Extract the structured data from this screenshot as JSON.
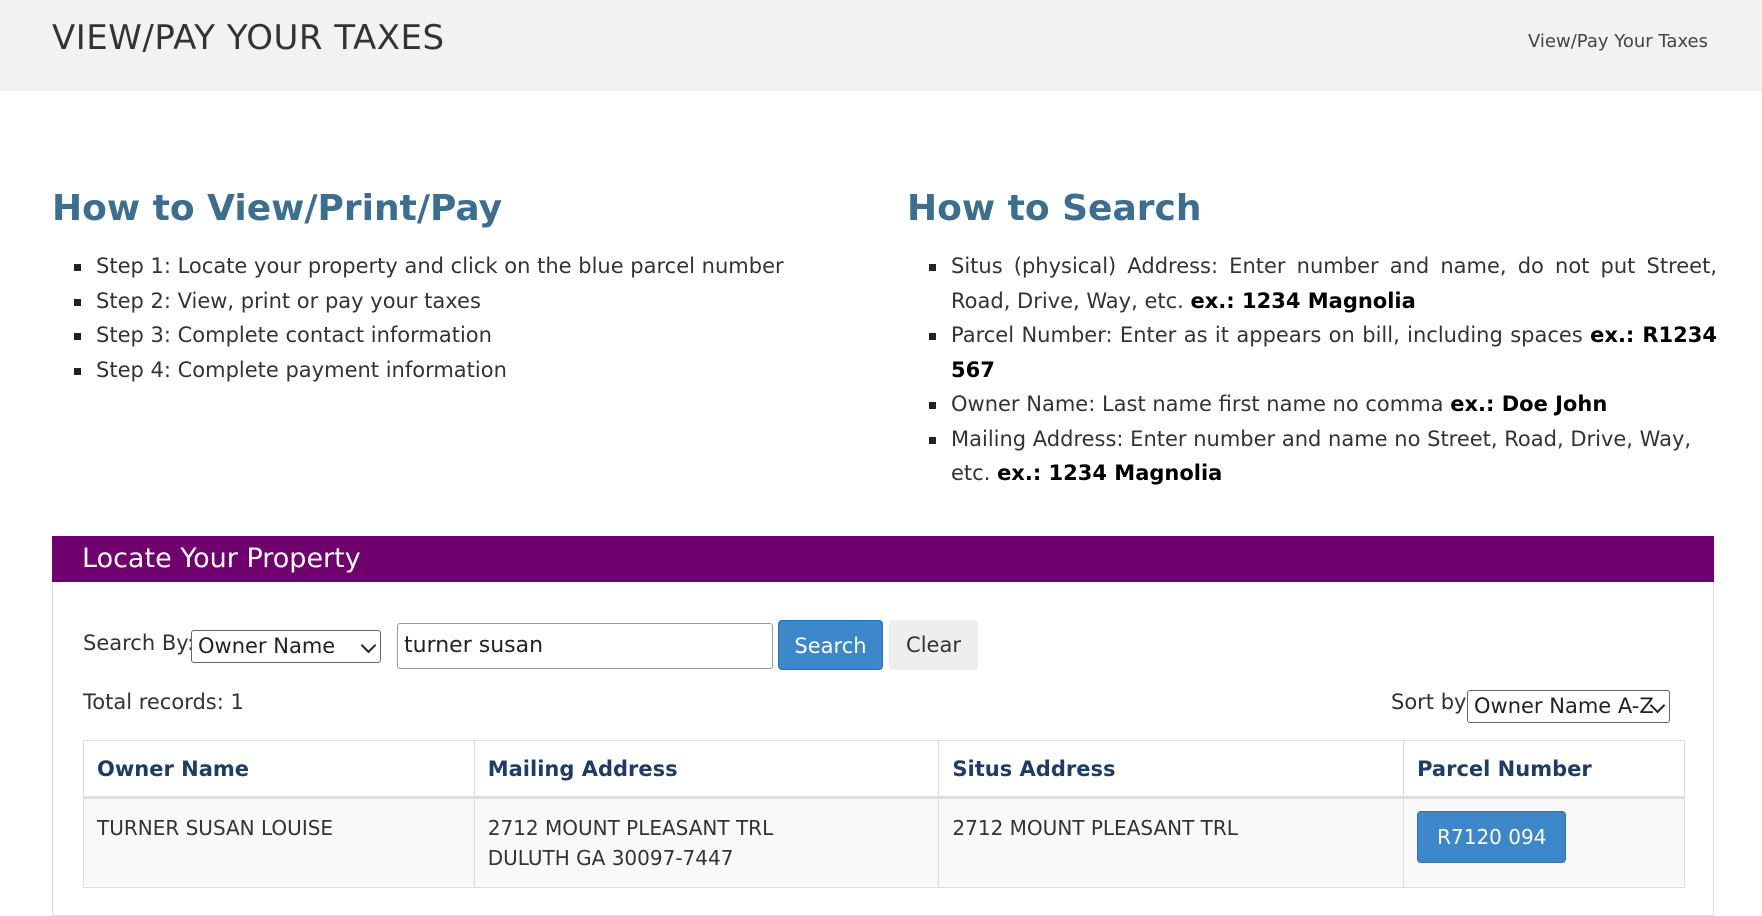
{
  "header": {
    "title": "VIEW/PAY YOUR TAXES",
    "breadcrumb": "View/Pay Your Taxes"
  },
  "howto": {
    "heading": "How to View/Print/Pay",
    "steps": [
      "Step 1: Locate your property and click on the blue parcel number",
      "Step 2: View, print or pay your taxes",
      "Step 3: Complete contact information",
      "Step 4: Complete payment information"
    ]
  },
  "search_help": {
    "heading": "How to Search",
    "items": [
      {
        "text": "Situs (physical) Address: Enter number and name, do not put Street, Road, Drive, Way, etc.",
        "example": "ex.: 1234 Magnolia"
      },
      {
        "text": "Parcel Number: Enter as it appears on bill, including spaces",
        "example": "ex.: R1234 567"
      },
      {
        "text": "Owner Name: Last name first name no comma",
        "example": "ex.: Doe John"
      },
      {
        "text": "Mailing Address: Enter number and name no Street, Road, Drive, Way, etc.",
        "example": "ex.: 1234 Magnolia"
      }
    ]
  },
  "locate": {
    "title": "Locate Your Property",
    "search_by_label": "Search By:",
    "search_by_value": "Owner Name",
    "search_value": "turner susan",
    "search_button": "Search",
    "clear_button": "Clear",
    "total_records": "Total records: 1",
    "sort_label": "Sort by",
    "sort_value": "Owner Name A-Z"
  },
  "table": {
    "columns": [
      "Owner Name",
      "Mailing Address",
      "Situs Address",
      "Parcel Number"
    ],
    "rows": [
      {
        "owner": "TURNER SUSAN LOUISE",
        "mailing_line1": "2712 MOUNT PLEASANT TRL",
        "mailing_line2": "DULUTH GA 30097-7447",
        "situs": "2712 MOUNT PLEASANT TRL",
        "parcel": "R7120 094"
      }
    ]
  },
  "colors": {
    "panel_header": "#70006e",
    "heading_blue": "#3b6e8f",
    "button_blue": "#3b87c9"
  }
}
